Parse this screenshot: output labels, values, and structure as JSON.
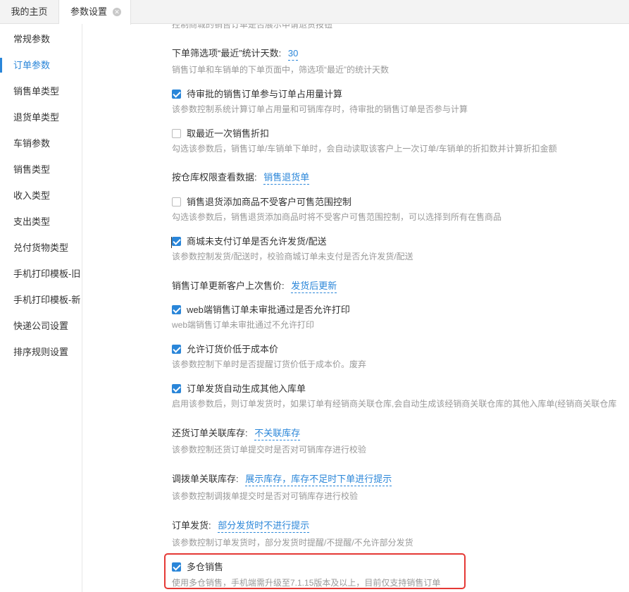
{
  "tabs": {
    "home": "我的主页",
    "params": "参数设置",
    "close_glyph": "✕"
  },
  "sidebar": {
    "items": [
      {
        "label": "常规参数"
      },
      {
        "label": "订单参数"
      },
      {
        "label": "销售单类型"
      },
      {
        "label": "退货单类型"
      },
      {
        "label": "车销参数"
      },
      {
        "label": "销售类型"
      },
      {
        "label": "收入类型"
      },
      {
        "label": "支出类型"
      },
      {
        "label": "兑付货物类型"
      },
      {
        "label": "手机打印模板-旧"
      },
      {
        "label": "手机打印模板-新"
      },
      {
        "label": "快递公司设置"
      },
      {
        "label": "排序规则设置"
      }
    ],
    "active_index": 1
  },
  "settings": {
    "top_cut_desc": "控制商城的销售订单是否展示申请退货按钮",
    "recent_days": {
      "label": "下单筛选项“最近”统计天数:",
      "value": "30",
      "desc": "销售订单和车销单的下单页面中，筛选项“最近”的统计天数"
    },
    "pending_occupy": {
      "label": "待审批的销售订单参与订单占用量计算",
      "checked": true,
      "desc": "该参数控制系统计算订单占用量和可销库存时，待审批的销售订单是否参与计算"
    },
    "last_discount": {
      "label": "取最近一次销售折扣",
      "checked": false,
      "desc": "勾选该参数后，销售订单/车销单下单时，会自动读取该客户上一次订单/车销单的折扣数并计算折扣金额"
    },
    "warehouse_view": {
      "label": "按仓库权限查看数据:",
      "value": "销售退货单"
    },
    "return_no_range": {
      "label": "销售退货添加商品不受客户可售范围控制",
      "checked": false,
      "desc": "勾选该参数后，销售退货添加商品时将不受客户可售范围控制，可以选择到所有在售商品"
    },
    "mall_unpaid": {
      "label": "商城未支付订单是否允许发货/配送",
      "checked": true,
      "desc": "该参数控制发货/配送时，校验商城订单未支付是否允许发货/配送"
    },
    "last_price": {
      "label": "销售订单更新客户上次售价:",
      "value": "发货后更新"
    },
    "web_print": {
      "label": "web端销售订单未审批通过是否允许打印",
      "checked": true,
      "desc": "web端销售订单未审批通过不允许打印"
    },
    "below_cost": {
      "label": "允许订货价低于成本价",
      "checked": true,
      "desc": "该参数控制下单时是否提醒订货价低于成本价。废弃"
    },
    "auto_inbound": {
      "label": "订单发货自动生成其他入库单",
      "checked": true,
      "desc": "启用该参数后，则订单发货时，如果订单有经销商关联仓库,会自动生成该经销商关联仓库的其他入库单(经销商关联仓库"
    },
    "return_stock": {
      "label": "还货订单关联库存:",
      "value": "不关联库存",
      "desc": "该参数控制还货订单提交时是否对可销库存进行校验"
    },
    "transfer_stock": {
      "label": "调拨单关联库存:",
      "value": "展示库存，库存不足时下单进行提示",
      "desc": "该参数控制调拨单提交时是否对可销库存进行校验"
    },
    "order_ship": {
      "label": "订单发货:",
      "value": "部分发货时不进行提示",
      "desc": "该参数控制订单发货时，部分发货时提醒/不提醒/不允许部分发货"
    },
    "multi_warehouse": {
      "label": "多仓销售",
      "checked": true,
      "desc": "使用多仓销售，手机端需升级至7.1.15版本及以上，目前仅支持销售订单"
    }
  },
  "colors": {
    "accent": "#2a86d9",
    "highlight": "#e53935",
    "muted": "#999999"
  }
}
